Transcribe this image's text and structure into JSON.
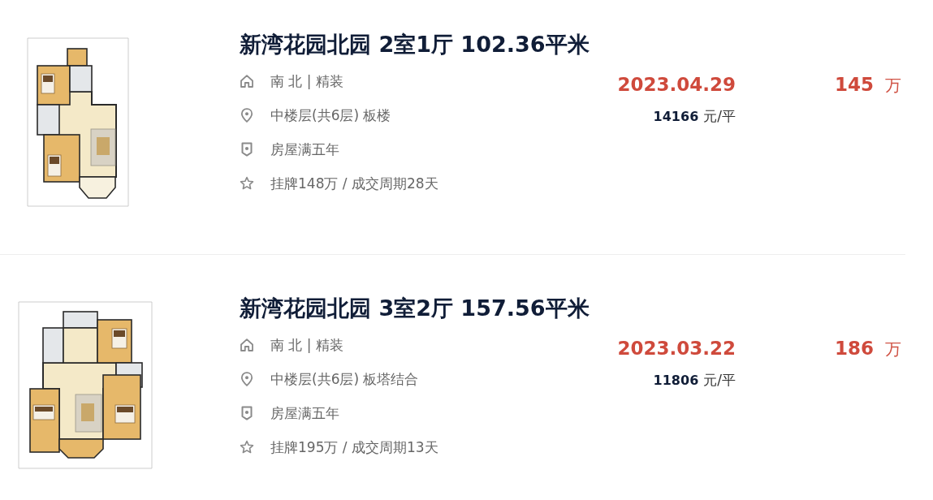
{
  "listings": [
    {
      "title": "新湾花园北园 2室1厅 102.36平米",
      "details": [
        {
          "kind": "orientation",
          "text": "南 北 | 精装"
        },
        {
          "kind": "floor",
          "text": "中楼层(共6层) 板楼"
        },
        {
          "kind": "tag",
          "text": "房屋满五年"
        },
        {
          "kind": "history",
          "text": "挂牌148万 / 成交周期28天"
        }
      ],
      "deal_date": "2023.04.29",
      "unit_price": "14166",
      "unit_price_unit": "元/平",
      "total_price": "145",
      "total_price_unit": "万"
    },
    {
      "title": "新湾花园北园 3室2厅 157.56平米",
      "details": [
        {
          "kind": "orientation",
          "text": "南 北 | 精装"
        },
        {
          "kind": "floor",
          "text": "中楼层(共6层) 板塔结合"
        },
        {
          "kind": "tag",
          "text": "房屋满五年"
        },
        {
          "kind": "history",
          "text": "挂牌195万 / 成交周期13天"
        }
      ],
      "deal_date": "2023.03.22",
      "unit_price": "11806",
      "unit_price_unit": "元/平",
      "total_price": "186",
      "total_price_unit": "万"
    }
  ]
}
